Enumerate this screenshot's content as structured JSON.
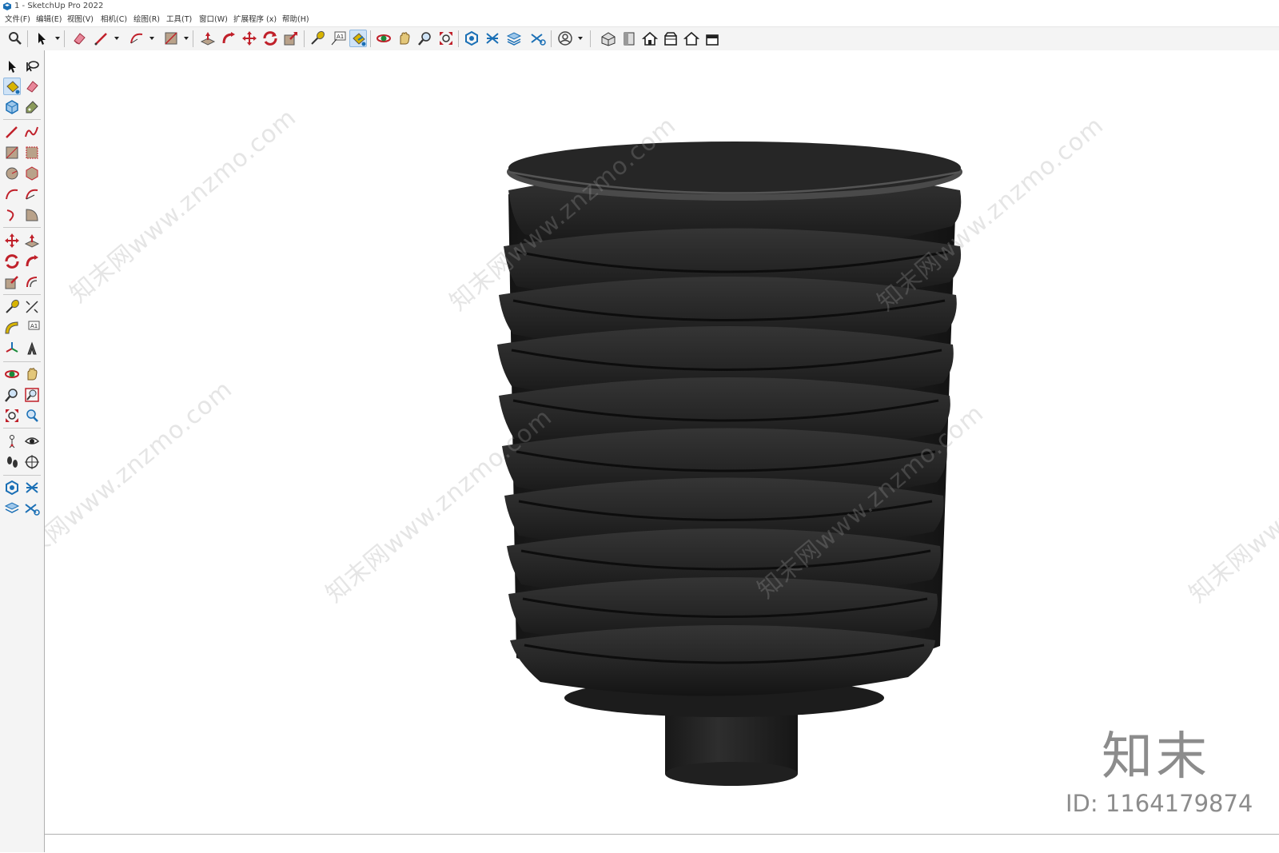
{
  "window": {
    "title": "1 - SketchUp Pro 2022"
  },
  "menu": {
    "items": [
      {
        "label": "文件(F)"
      },
      {
        "label": "编辑(E)"
      },
      {
        "label": "视图(V)"
      },
      {
        "label": "相机(C)"
      },
      {
        "label": "绘图(R)"
      },
      {
        "label": "工具(T)"
      },
      {
        "label": "窗口(W)"
      },
      {
        "label": "扩展程序 (x)"
      },
      {
        "label": "帮助(H)"
      }
    ]
  },
  "toolbar": {
    "tools": [
      "search-icon",
      "select-icon",
      "eraser-icon",
      "line-icon",
      "arc-icon",
      "rectangle-icon",
      "push-pull-icon",
      "follow-me-icon",
      "move-icon",
      "rotate-icon",
      "scale-icon",
      "tape-measure-icon",
      "text-icon",
      "paint-bucket-icon",
      "orbit-icon",
      "pan-icon",
      "zoom-icon",
      "zoom-extents-icon",
      "components-icon",
      "sections-icon",
      "layers-icon",
      "section-plane-icon",
      "account-icon",
      "iso-view-icon",
      "front-view-icon",
      "top-view-icon",
      "side-view-icon",
      "home-view-icon",
      "back-view-icon"
    ],
    "active_tool": "paint-bucket-icon"
  },
  "sidebar": {
    "active_tool": "paint-bucket-icon"
  },
  "watermark": {
    "url_text": "知末网www.znzmo.com",
    "brand": "知末",
    "id_text": "ID: 1164179874"
  },
  "colors": {
    "model_body": "#262626",
    "model_highlight": "#3a3a3a",
    "model_shadow": "#141414",
    "active_tool_bg": "#cfe3f6",
    "icon_red": "#c0202a",
    "icon_blue": "#1a6fb5"
  }
}
